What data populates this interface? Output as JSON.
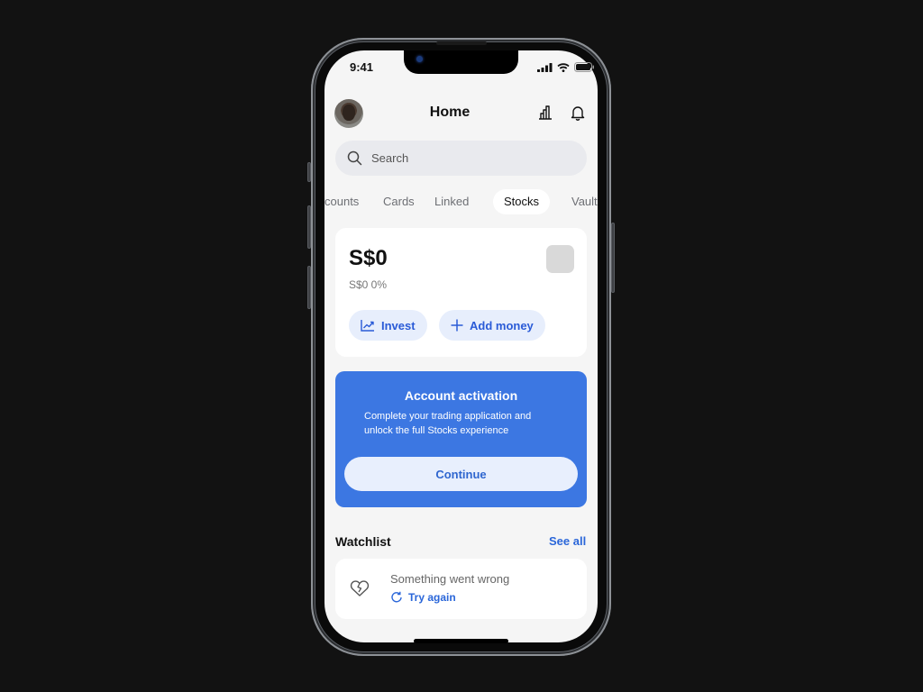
{
  "status_bar": {
    "time": "9:41",
    "icons": [
      "signal-icon",
      "wifi-icon",
      "battery-icon"
    ]
  },
  "header": {
    "title": "Home",
    "avatar": "user-avatar",
    "icons": [
      "bar-chart-icon",
      "bell-icon"
    ]
  },
  "search": {
    "placeholder": "Search",
    "value": ""
  },
  "tabs": [
    {
      "label": "Accounts",
      "visible_text": "counts",
      "active": false
    },
    {
      "label": "Cards",
      "active": false
    },
    {
      "label": "Linked",
      "active": false
    },
    {
      "label": "Stocks",
      "active": true
    },
    {
      "label": "Vault",
      "visible_text": "Vaul",
      "active": false
    }
  ],
  "balance": {
    "amount": "S$0",
    "change": "S$0 0%",
    "actions": [
      {
        "label": "Invest",
        "icon": "trend-chart-icon"
      },
      {
        "label": "Add money",
        "icon": "plus-icon"
      }
    ]
  },
  "activation": {
    "title": "Account activation",
    "description": "Complete your trading application and unlock the full Stocks experience",
    "button": "Continue"
  },
  "watchlist": {
    "title": "Watchlist",
    "see_all": "See all",
    "error": "Something went wrong",
    "retry": "Try again"
  },
  "colors": {
    "accent": "#3c77e2",
    "link": "#2a66d9",
    "pill_bg": "#e7eefc",
    "screen_bg": "#f5f5f5"
  }
}
